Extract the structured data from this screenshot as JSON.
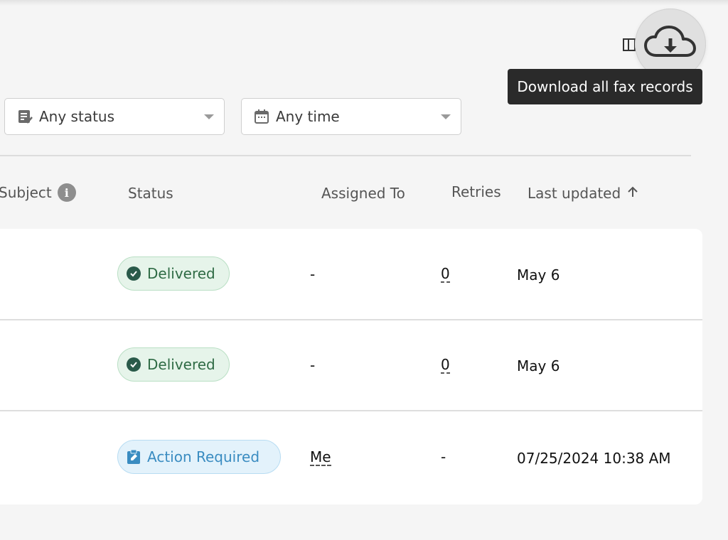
{
  "toolbar": {
    "tooltip": "Download all fax records",
    "columns_icon": "columns-icon",
    "download_icon": "cloud-download-icon"
  },
  "filters": {
    "status": {
      "label": "Any status",
      "icon": "status-list-icon"
    },
    "time": {
      "label": "Any time",
      "icon": "calendar-icon"
    }
  },
  "table": {
    "headers": {
      "subject": "Subject",
      "status": "Status",
      "assigned_to": "Assigned To",
      "retries": "Retries",
      "last_updated": "Last updated"
    },
    "rows": [
      {
        "status": "Delivered",
        "assigned_to": "-",
        "retries": "0",
        "last_updated": "May 6"
      },
      {
        "status": "Delivered",
        "assigned_to": "-",
        "retries": "0",
        "last_updated": "May 6"
      },
      {
        "status": "Action Required",
        "assigned_to": "Me",
        "retries": "-",
        "last_updated": "07/25/2024 10:38 AM"
      }
    ]
  },
  "colors": {
    "delivered_bg": "#e6f4ea",
    "delivered_text": "#2f6b45",
    "action_bg": "#e3f2fb",
    "action_text": "#3a8cc1"
  }
}
